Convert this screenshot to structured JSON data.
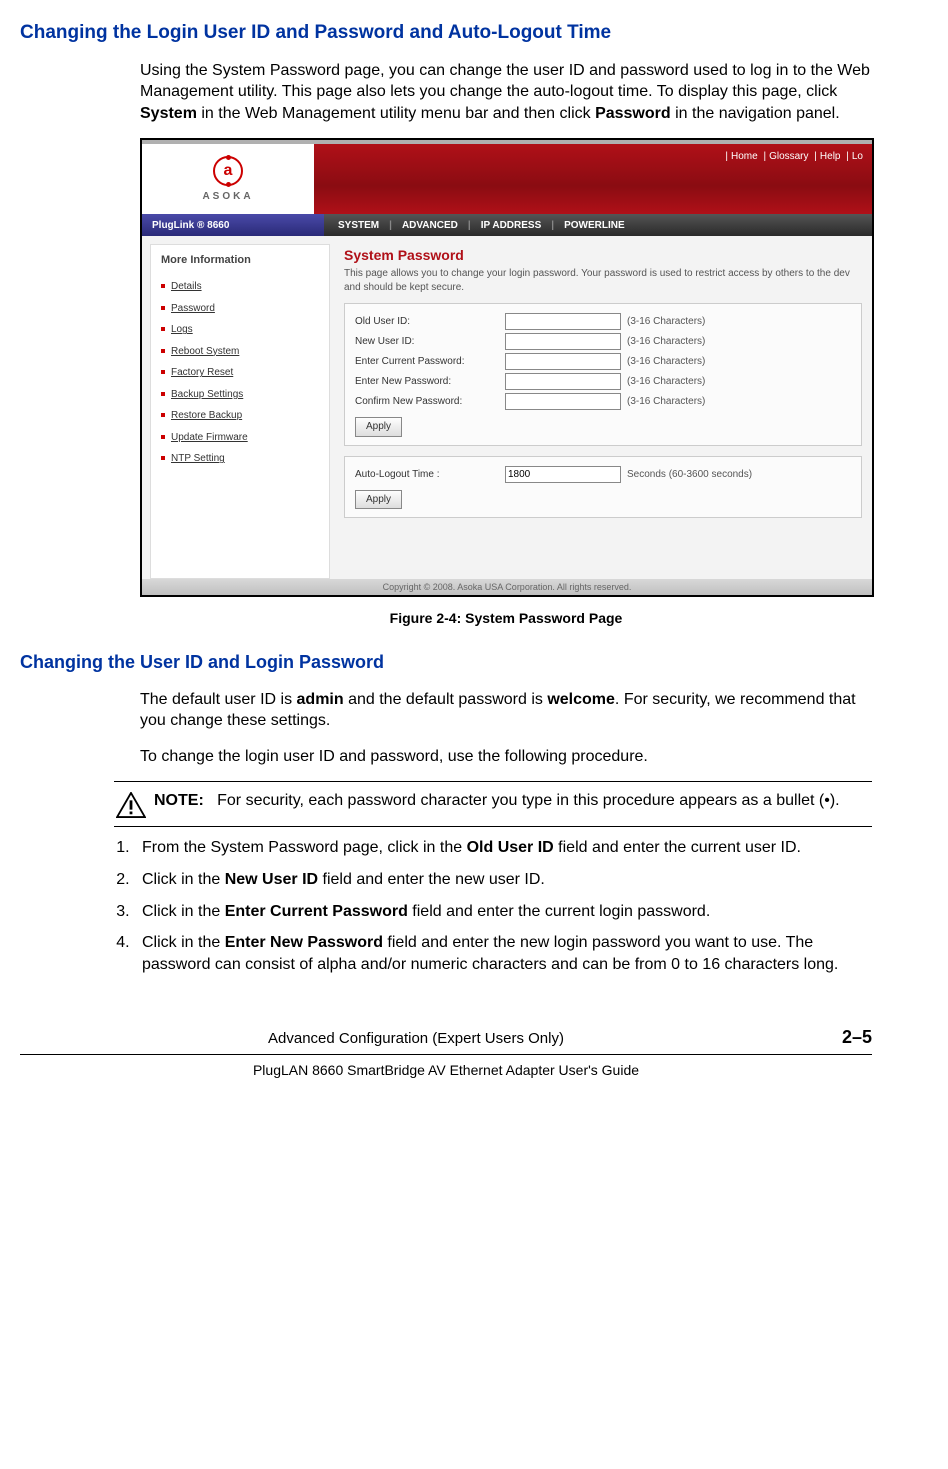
{
  "heading1": "Changing the Login User ID and Password and Auto-Logout Time",
  "intro_text_parts": {
    "p1a": "Using the System Password page, you can change the user ID and password used to log in to the Web Management utility. This page also lets you change the auto-logout time. To display this page, click ",
    "p1b": "System",
    "p1c": " in the Web Management utility menu bar and then click ",
    "p1d": "Password",
    "p1e": " in the navigation panel."
  },
  "figure_caption": "Figure 2-4:  System Password Page",
  "screenshot": {
    "logo_text": "ASOKA",
    "banner_links": [
      "Home",
      "Glossary",
      "Help",
      "Lo"
    ],
    "product_label": "PlugLink ®  8660",
    "menu_items": [
      "SYSTEM",
      "ADVANCED",
      "IP ADDRESS",
      "POWERLINE"
    ],
    "sidebar_title": "More Information",
    "sidebar_items": [
      "Details",
      "Password",
      "Logs",
      "Reboot System",
      "Factory Reset",
      "Backup Settings",
      "Restore Backup",
      "Update Firmware",
      "NTP Setting"
    ],
    "main_title": "System Password",
    "main_desc": "This page allows you to change your login password. Your password is used to restrict access by others to the dev and should be kept secure.",
    "form1": {
      "rows": [
        {
          "label": "Old User ID:",
          "value": "",
          "hint": "(3-16 Characters)"
        },
        {
          "label": "New User ID:",
          "value": "",
          "hint": "(3-16 Characters)"
        },
        {
          "label": "Enter Current Password:",
          "value": "",
          "hint": "(3-16 Characters)"
        },
        {
          "label": "Enter New Password:",
          "value": "",
          "hint": "(3-16 Characters)"
        },
        {
          "label": "Confirm New Password:",
          "value": "",
          "hint": "(3-16 Characters)"
        }
      ],
      "apply": "Apply"
    },
    "form2": {
      "label": "Auto-Logout Time :",
      "value": "1800",
      "hint": "Seconds (60-3600 seconds)",
      "apply": "Apply"
    },
    "copyright": "Copyright © 2008. Asoka USA Corporation. All rights reserved."
  },
  "heading2": "Changing the User ID and Login Password",
  "para2_parts": {
    "a": "The default user ID is ",
    "b": "admin",
    "c": " and the default password is ",
    "d": "welcome",
    "e": ". For security, we recommend that you change these settings."
  },
  "para3": "To change the login user ID and password, use the following procedure.",
  "note": {
    "label": "NOTE:",
    "text": "For security, each password character you type in this procedure appears as a bullet (•)."
  },
  "steps": [
    {
      "a": "From the System Password page, click in the ",
      "b": "Old User ID",
      "c": " field and enter the current user ID."
    },
    {
      "a": "Click in the ",
      "b": "New User ID",
      "c": " field and enter the new user ID."
    },
    {
      "a": "Click in the ",
      "b": "Enter Current Password",
      "c": " field and enter the current login password."
    },
    {
      "a": "Click in the ",
      "b": "Enter New Password",
      "c": " field and enter the new login password you want to use. The password can consist of alpha and/or numeric characters and can be from 0 to 16 characters long."
    }
  ],
  "footer": {
    "center": "Advanced Configuration (Expert Users Only)",
    "pagenum": "2–5",
    "line2": "PlugLAN 8660 SmartBridge AV Ethernet Adapter User's Guide"
  }
}
